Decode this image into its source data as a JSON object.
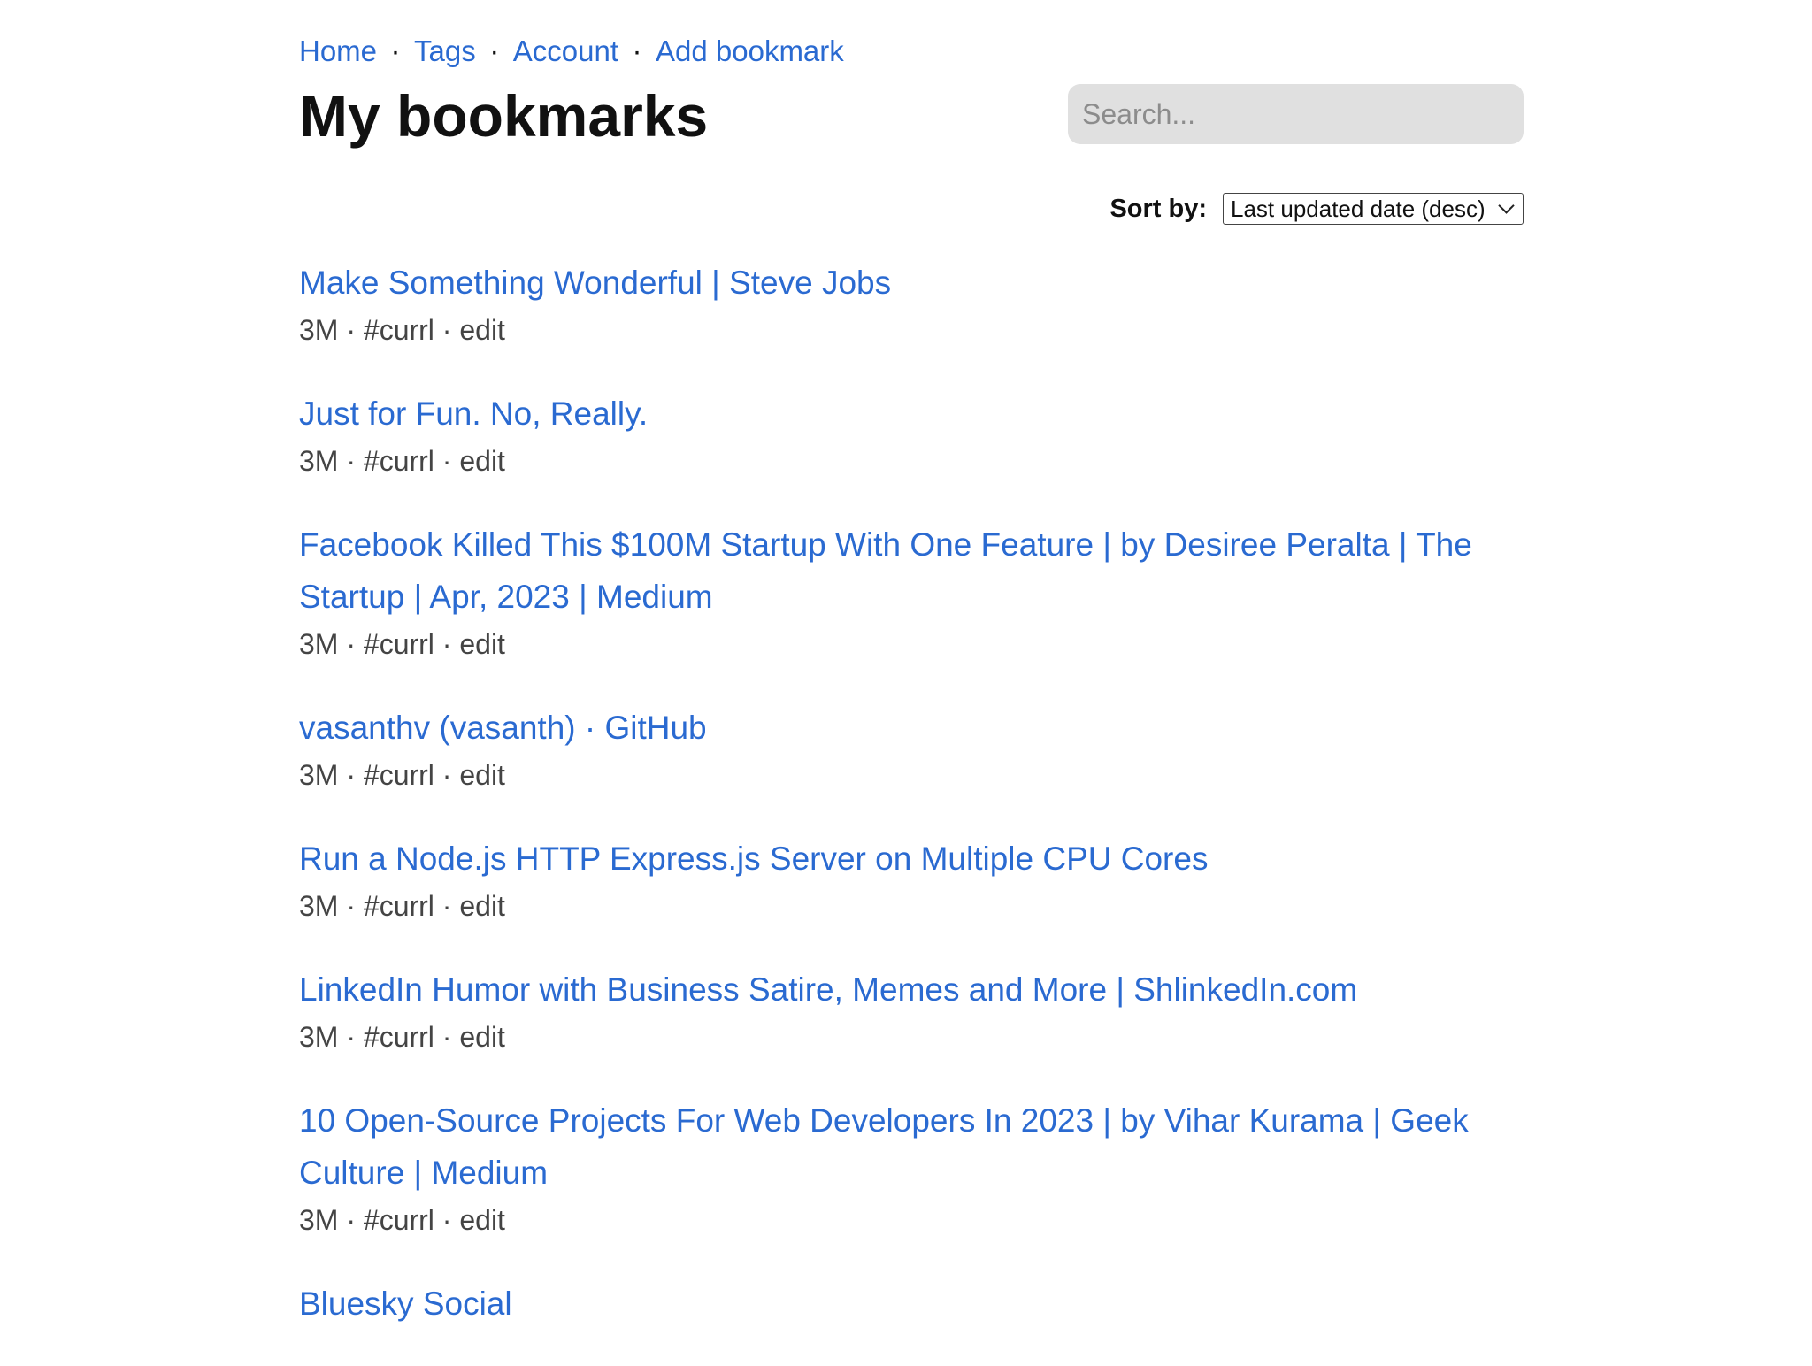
{
  "nav": {
    "items": [
      {
        "label": "Home"
      },
      {
        "label": "Tags"
      },
      {
        "label": "Account"
      },
      {
        "label": "Add bookmark"
      }
    ],
    "separator": "·"
  },
  "page_title": "My bookmarks",
  "search": {
    "placeholder": "Search...",
    "value": ""
  },
  "sort": {
    "label": "Sort by:",
    "selected": "Last updated date (desc)"
  },
  "bookmarks": [
    {
      "title": "Make Something Wonderful | Steve Jobs",
      "age": "3M",
      "tag": "#currl",
      "edit_label": "edit"
    },
    {
      "title": "Just for Fun. No, Really.",
      "age": "3M",
      "tag": "#currl",
      "edit_label": "edit"
    },
    {
      "title": "Facebook Killed This $100M Startup With One Feature | by Desiree Peralta | The Startup | Apr, 2023 | Medium",
      "age": "3M",
      "tag": "#currl",
      "edit_label": "edit"
    },
    {
      "title": "vasanthv (vasanth) · GitHub",
      "age": "3M",
      "tag": "#currl",
      "edit_label": "edit"
    },
    {
      "title": "Run a Node.js HTTP Express.js Server on Multiple CPU Cores",
      "age": "3M",
      "tag": "#currl",
      "edit_label": "edit"
    },
    {
      "title": "LinkedIn Humor with Business Satire, Memes and More | ShlinkedIn.com",
      "age": "3M",
      "tag": "#currl",
      "edit_label": "edit"
    },
    {
      "title": "10 Open-Source Projects For Web Developers In 2023 | by Vihar Kurama | Geek Culture | Medium",
      "age": "3M",
      "tag": "#currl",
      "edit_label": "edit"
    },
    {
      "title": "Bluesky Social",
      "age": "",
      "tag": "",
      "edit_label": ""
    }
  ],
  "colors": {
    "link": "#2a6ad1",
    "text": "#111111",
    "meta": "#444444",
    "search_bg": "#e0e0e0"
  }
}
